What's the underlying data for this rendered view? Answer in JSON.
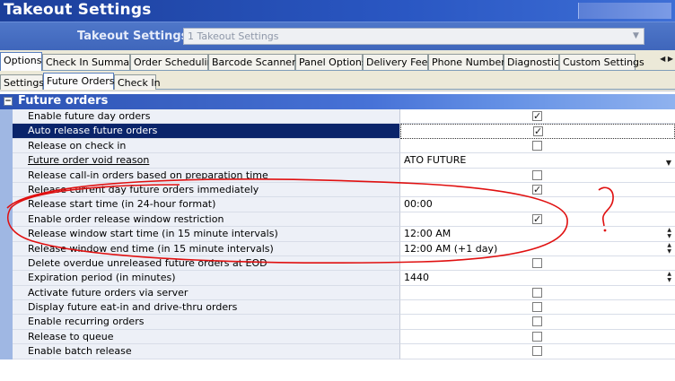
{
  "window": {
    "title": "Takeout Settings"
  },
  "settings_selector": {
    "label": "Takeout Settings:",
    "value": "1 Takeout Settings"
  },
  "tabs_primary": [
    {
      "label": "Options",
      "active": true
    },
    {
      "label": "Check In Summary"
    },
    {
      "label": "Order Scheduling"
    },
    {
      "label": "Barcode Scanners"
    },
    {
      "label": "Panel Options"
    },
    {
      "label": "Delivery Fees"
    },
    {
      "label": "Phone Numbers"
    },
    {
      "label": "Diagnostics"
    },
    {
      "label": "Custom Settings"
    }
  ],
  "tabs_secondary": [
    {
      "label": "Settings"
    },
    {
      "label": "Future Orders",
      "active": true
    },
    {
      "label": "Check In"
    }
  ],
  "group": {
    "toggle": "−",
    "title": "Future orders"
  },
  "rows": [
    {
      "label": "Enable future day orders",
      "type": "checkbox",
      "checked": true
    },
    {
      "label": "Auto release future orders",
      "type": "checkbox",
      "checked": true,
      "selected": true
    },
    {
      "label": "Release on check in",
      "type": "checkbox",
      "checked": false
    },
    {
      "label": "Future order void reason",
      "type": "dropdown",
      "value": "ATO FUTURE",
      "underline": true
    },
    {
      "label": "Release call-in orders based on preparation time",
      "type": "checkbox",
      "checked": false
    },
    {
      "label": "Release current day future orders immediately",
      "type": "checkbox",
      "checked": true
    },
    {
      "label": "Release start time (in 24-hour format)",
      "type": "text",
      "value": "00:00"
    },
    {
      "label": "Enable order release window restriction",
      "type": "checkbox",
      "checked": true
    },
    {
      "label": "Release window start time (in 15 minute intervals)",
      "type": "spin",
      "value": "12:00 AM"
    },
    {
      "label": "Release window end time (in 15 minute intervals)",
      "type": "spin",
      "value": "12:00 AM (+1 day)"
    },
    {
      "label": "Delete overdue unreleased future orders at EOD",
      "type": "checkbox",
      "checked": false
    },
    {
      "label": "Expiration period (in minutes)",
      "type": "spin",
      "value": "1440"
    },
    {
      "label": "Activate future orders via server",
      "type": "checkbox",
      "checked": false
    },
    {
      "label": "Display future eat-in and drive-thru orders",
      "type": "checkbox",
      "checked": false
    },
    {
      "label": "Enable recurring orders",
      "type": "checkbox",
      "checked": false
    },
    {
      "label": "Release to queue",
      "type": "checkbox",
      "checked": false
    },
    {
      "label": "Enable batch release",
      "type": "checkbox",
      "checked": false
    }
  ],
  "annotation": {
    "color": "#e01010"
  }
}
